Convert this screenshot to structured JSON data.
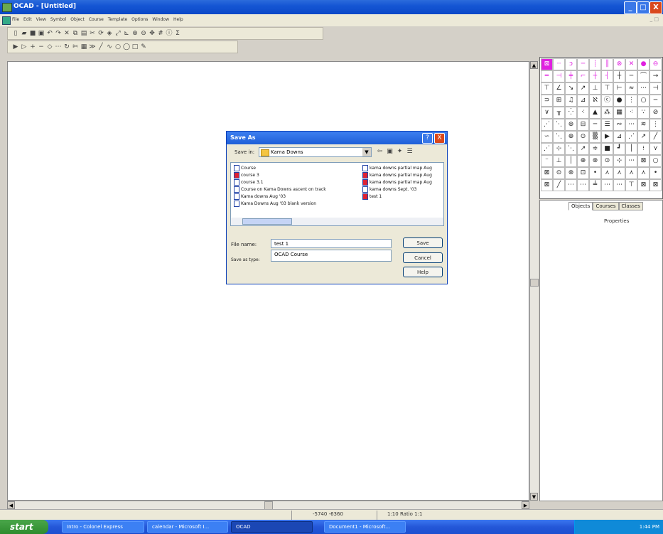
{
  "window": {
    "title": "OCAD - [Untitled]",
    "controls": [
      "_",
      "□",
      "X"
    ]
  },
  "menu": {
    "items": [
      "File",
      "Edit",
      "View",
      "Symbol",
      "Object",
      "Course",
      "Template",
      "Options",
      "Window",
      "Help"
    ],
    "mdi_controls": "_ □"
  },
  "toolbar1": {
    "icons": [
      "new",
      "open",
      "save",
      "print",
      "undo",
      "redo",
      "cut",
      "copy",
      "paste",
      "delete",
      "grid",
      "zoom-in",
      "zoom-out",
      "pan",
      "info",
      "count"
    ]
  },
  "toolbar2": {
    "icons": [
      "edit-object",
      "edit-point",
      "add-point",
      "delete-point",
      "corner-point",
      "dash-point",
      "rotate",
      "cut",
      "fill",
      "mode",
      "straight",
      "curve",
      "circle",
      "rectangle",
      "freehand",
      "numeric"
    ]
  },
  "symbols_panel": {
    "tabs": [
      "Objects",
      "Courses",
      "Classes"
    ],
    "active_tab": "Objects",
    "properties_label": "Properties"
  },
  "status": {
    "coords": "-5740 -6360",
    "zoom": "1:10    Ratio 1:1"
  },
  "taskbar": {
    "start": "start",
    "tasks": [
      {
        "label": "Intro - Colonel Express"
      },
      {
        "label": "calendar - Microsoft I..."
      },
      {
        "label": "OCAD"
      },
      {
        "label": "Document1 - Microsoft..."
      }
    ],
    "clock": "1:44 PM"
  },
  "dialog": {
    "title": "Save As",
    "help": "?",
    "close": "X",
    "save_in_label": "Save in:",
    "save_in_value": "Kama Downs",
    "files": [
      {
        "name": "Course",
        "type": "doc"
      },
      {
        "name": "course 3",
        "type": "ocd"
      },
      {
        "name": "course 3.1",
        "type": "doc"
      },
      {
        "name": "Course on Kama Downs ascent on track",
        "type": "doc"
      },
      {
        "name": "Kama downs Aug '03",
        "type": "doc"
      },
      {
        "name": "Kama Downs Aug '03 blank version",
        "type": "doc"
      },
      {
        "name": "kama downs partial map Aug",
        "type": "doc"
      },
      {
        "name": "kama downs partial map Aug",
        "type": "ocd"
      },
      {
        "name": "kama downs partial map Aug",
        "type": "ocd"
      },
      {
        "name": "kama downs Sept. '03",
        "type": "doc"
      },
      {
        "name": "test 1",
        "type": "ocd"
      }
    ],
    "file_name_label": "File name:",
    "file_name_value": "test 1",
    "file_type_label": "Save as type:",
    "file_type_value": "OCAD Course",
    "buttons": {
      "save": "Save",
      "cancel": "Cancel",
      "help": "Help"
    }
  }
}
